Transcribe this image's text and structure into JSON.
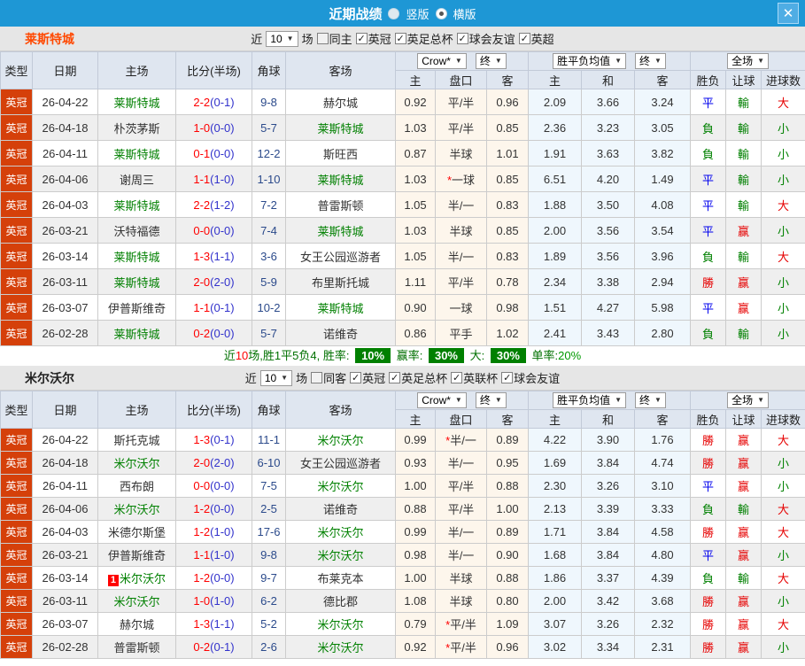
{
  "titlebar": {
    "title": "近期战绩",
    "radio_vertical": "竖版",
    "radio_horizontal": "横版"
  },
  "icons": {
    "close": "✕",
    "dropdown_arrow": "▼",
    "checkbox_check": "✓"
  },
  "colors": {
    "header_blue": "#1e97d5",
    "league_red": "#d5400a",
    "team_green": "#008000",
    "team1_orange": "#ff4800",
    "score_red": "#ff0000",
    "halftime_blue": "#3333cc",
    "win_red": "#e60000",
    "draw_blue": "#0000ee",
    "lose_green": "#008000",
    "stats_badge_green": "#008000"
  },
  "table_header": {
    "type": "类型",
    "date": "日期",
    "home": "主场",
    "score": "比分(半场)",
    "corner": "角球",
    "away": "客场",
    "odds_home": "主",
    "handicap": "盘口",
    "odds_away": "客",
    "avg_home": "主",
    "avg_draw": "和",
    "avg_away": "客",
    "result": "胜负",
    "handicap_result": "让球",
    "goals": "进球数",
    "select_company": "Crow*",
    "select_final1": "终",
    "select_avg": "胜平负均值",
    "select_final2": "终",
    "select_scope": "全场"
  },
  "sections": [
    {
      "team": "莱斯特城",
      "filter": {
        "near_label": "近",
        "count": "10",
        "games_label": "场",
        "same_label": "同主",
        "same_checked": false,
        "leagues": [
          "英冠",
          "英足总杯",
          "球会友谊",
          "英超"
        ]
      },
      "rows": [
        {
          "league": "英冠",
          "date": "26-04-22",
          "home": "莱斯特城",
          "homeGreen": true,
          "scoreFT": "2-2",
          "scoreHT": "(0-1)",
          "corner": "9-8",
          "away": "赫尔城",
          "awayGreen": false,
          "oddsH": "0.92",
          "star": false,
          "handicap": "平/半",
          "oddsA": "0.96",
          "avgH": "2.09",
          "avgD": "3.66",
          "avgA": "3.24",
          "res": "平",
          "resC": "b",
          "let": "輸",
          "letC": "g",
          "goal": "大",
          "goalC": "r"
        },
        {
          "league": "英冠",
          "date": "26-04-18",
          "home": "朴茨茅斯",
          "homeGreen": false,
          "scoreFT": "1-0",
          "scoreHT": "(0-0)",
          "corner": "5-7",
          "away": "莱斯特城",
          "awayGreen": true,
          "oddsH": "1.03",
          "star": false,
          "handicap": "平/半",
          "oddsA": "0.85",
          "avgH": "2.36",
          "avgD": "3.23",
          "avgA": "3.05",
          "res": "負",
          "resC": "g",
          "let": "輸",
          "letC": "g",
          "goal": "小",
          "goalC": "g"
        },
        {
          "league": "英冠",
          "date": "26-04-11",
          "home": "莱斯特城",
          "homeGreen": true,
          "scoreFT": "0-1",
          "scoreHT": "(0-0)",
          "corner": "12-2",
          "away": "斯旺西",
          "awayGreen": false,
          "oddsH": "0.87",
          "star": false,
          "handicap": "半球",
          "oddsA": "1.01",
          "avgH": "1.91",
          "avgD": "3.63",
          "avgA": "3.82",
          "res": "負",
          "resC": "g",
          "let": "輸",
          "letC": "g",
          "goal": "小",
          "goalC": "g"
        },
        {
          "league": "英冠",
          "date": "26-04-06",
          "home": "谢周三",
          "homeGreen": false,
          "scoreFT": "1-1",
          "scoreHT": "(1-0)",
          "corner": "1-10",
          "away": "莱斯特城",
          "awayGreen": true,
          "oddsH": "1.03",
          "star": true,
          "handicap": "一球",
          "oddsA": "0.85",
          "avgH": "6.51",
          "avgD": "4.20",
          "avgA": "1.49",
          "res": "平",
          "resC": "b",
          "let": "輸",
          "letC": "g",
          "goal": "小",
          "goalC": "g"
        },
        {
          "league": "英冠",
          "date": "26-04-03",
          "home": "莱斯特城",
          "homeGreen": true,
          "scoreFT": "2-2",
          "scoreHT": "(1-2)",
          "corner": "7-2",
          "away": "普雷斯顿",
          "awayGreen": false,
          "oddsH": "1.05",
          "star": false,
          "handicap": "半/一",
          "oddsA": "0.83",
          "avgH": "1.88",
          "avgD": "3.50",
          "avgA": "4.08",
          "res": "平",
          "resC": "b",
          "let": "輸",
          "letC": "g",
          "goal": "大",
          "goalC": "r"
        },
        {
          "league": "英冠",
          "date": "26-03-21",
          "home": "沃特福德",
          "homeGreen": false,
          "scoreFT": "0-0",
          "scoreHT": "(0-0)",
          "corner": "7-4",
          "away": "莱斯特城",
          "awayGreen": true,
          "oddsH": "1.03",
          "star": false,
          "handicap": "半球",
          "oddsA": "0.85",
          "avgH": "2.00",
          "avgD": "3.56",
          "avgA": "3.54",
          "res": "平",
          "resC": "b",
          "let": "赢",
          "letC": "r",
          "goal": "小",
          "goalC": "g"
        },
        {
          "league": "英冠",
          "date": "26-03-14",
          "home": "莱斯特城",
          "homeGreen": true,
          "scoreFT": "1-3",
          "scoreHT": "(1-1)",
          "corner": "3-6",
          "away": "女王公园巡游者",
          "awayGreen": false,
          "oddsH": "1.05",
          "star": false,
          "handicap": "半/一",
          "oddsA": "0.83",
          "avgH": "1.89",
          "avgD": "3.56",
          "avgA": "3.96",
          "res": "負",
          "resC": "g",
          "let": "輸",
          "letC": "g",
          "goal": "大",
          "goalC": "r"
        },
        {
          "league": "英冠",
          "date": "26-03-11",
          "home": "莱斯特城",
          "homeGreen": true,
          "scoreFT": "2-0",
          "scoreHT": "(2-0)",
          "corner": "5-9",
          "away": "布里斯托城",
          "awayGreen": false,
          "oddsH": "1.11",
          "star": false,
          "handicap": "平/半",
          "oddsA": "0.78",
          "avgH": "2.34",
          "avgD": "3.38",
          "avgA": "2.94",
          "res": "勝",
          "resC": "r",
          "let": "赢",
          "letC": "r",
          "goal": "小",
          "goalC": "g"
        },
        {
          "league": "英冠",
          "date": "26-03-07",
          "home": "伊普斯维奇",
          "homeGreen": false,
          "scoreFT": "1-1",
          "scoreHT": "(0-1)",
          "corner": "10-2",
          "away": "莱斯特城",
          "awayGreen": true,
          "oddsH": "0.90",
          "star": false,
          "handicap": "一球",
          "oddsA": "0.98",
          "avgH": "1.51",
          "avgD": "4.27",
          "avgA": "5.98",
          "res": "平",
          "resC": "b",
          "let": "赢",
          "letC": "r",
          "goal": "小",
          "goalC": "g"
        },
        {
          "league": "英冠",
          "date": "26-02-28",
          "home": "莱斯特城",
          "homeGreen": true,
          "scoreFT": "0-2",
          "scoreHT": "(0-0)",
          "corner": "5-7",
          "away": "诺维奇",
          "awayGreen": false,
          "oddsH": "0.86",
          "star": false,
          "handicap": "平手",
          "oddsA": "1.02",
          "avgH": "2.41",
          "avgD": "3.43",
          "avgA": "2.80",
          "res": "負",
          "resC": "g",
          "let": "輸",
          "letC": "g",
          "goal": "小",
          "goalC": "g"
        }
      ],
      "stats": {
        "t1": "近",
        "count": "10",
        "t2": "场,胜1平5负4, 胜率:",
        "win_rate": "10%",
        "t3": "赢率:",
        "let_rate": "30%",
        "t4": "大:",
        "big_rate": "30%",
        "t5": "单率:",
        "single_rate": "20%"
      }
    },
    {
      "team": "米尔沃尔",
      "filter": {
        "near_label": "近",
        "count": "10",
        "games_label": "场",
        "same_label": "同客",
        "same_checked": false,
        "leagues": [
          "英冠",
          "英足总杯",
          "英联杯",
          "球会友谊"
        ]
      },
      "rows": [
        {
          "league": "英冠",
          "date": "26-04-22",
          "home": "斯托克城",
          "homeGreen": false,
          "scoreFT": "1-3",
          "scoreHT": "(0-1)",
          "corner": "11-1",
          "away": "米尔沃尔",
          "awayGreen": true,
          "oddsH": "0.99",
          "star": true,
          "handicap": "半/一",
          "oddsA": "0.89",
          "avgH": "4.22",
          "avgD": "3.90",
          "avgA": "1.76",
          "res": "勝",
          "resC": "r",
          "let": "赢",
          "letC": "r",
          "goal": "大",
          "goalC": "r"
        },
        {
          "league": "英冠",
          "date": "26-04-18",
          "home": "米尔沃尔",
          "homeGreen": true,
          "scoreFT": "2-0",
          "scoreHT": "(2-0)",
          "corner": "6-10",
          "away": "女王公园巡游者",
          "awayGreen": false,
          "oddsH": "0.93",
          "star": false,
          "handicap": "半/一",
          "oddsA": "0.95",
          "avgH": "1.69",
          "avgD": "3.84",
          "avgA": "4.74",
          "res": "勝",
          "resC": "r",
          "let": "赢",
          "letC": "r",
          "goal": "小",
          "goalC": "g"
        },
        {
          "league": "英冠",
          "date": "26-04-11",
          "home": "西布朗",
          "homeGreen": false,
          "scoreFT": "0-0",
          "scoreHT": "(0-0)",
          "corner": "7-5",
          "away": "米尔沃尔",
          "awayGreen": true,
          "oddsH": "1.00",
          "star": false,
          "handicap": "平/半",
          "oddsA": "0.88",
          "avgH": "2.30",
          "avgD": "3.26",
          "avgA": "3.10",
          "res": "平",
          "resC": "b",
          "let": "赢",
          "letC": "r",
          "goal": "小",
          "goalC": "g"
        },
        {
          "league": "英冠",
          "date": "26-04-06",
          "home": "米尔沃尔",
          "homeGreen": true,
          "scoreFT": "1-2",
          "scoreHT": "(0-0)",
          "corner": "2-5",
          "away": "诺维奇",
          "awayGreen": false,
          "oddsH": "0.88",
          "star": false,
          "handicap": "平/半",
          "oddsA": "1.00",
          "avgH": "2.13",
          "avgD": "3.39",
          "avgA": "3.33",
          "res": "負",
          "resC": "g",
          "let": "輸",
          "letC": "g",
          "goal": "大",
          "goalC": "r"
        },
        {
          "league": "英冠",
          "date": "26-04-03",
          "home": "米德尔斯堡",
          "homeGreen": false,
          "scoreFT": "1-2",
          "scoreHT": "(1-0)",
          "corner": "17-6",
          "away": "米尔沃尔",
          "awayGreen": true,
          "oddsH": "0.99",
          "star": false,
          "handicap": "半/一",
          "oddsA": "0.89",
          "avgH": "1.71",
          "avgD": "3.84",
          "avgA": "4.58",
          "res": "勝",
          "resC": "r",
          "let": "赢",
          "letC": "r",
          "goal": "大",
          "goalC": "r"
        },
        {
          "league": "英冠",
          "date": "26-03-21",
          "home": "伊普斯维奇",
          "homeGreen": false,
          "scoreFT": "1-1",
          "scoreHT": "(1-0)",
          "corner": "9-8",
          "away": "米尔沃尔",
          "awayGreen": true,
          "oddsH": "0.98",
          "star": false,
          "handicap": "半/一",
          "oddsA": "0.90",
          "avgH": "1.68",
          "avgD": "3.84",
          "avgA": "4.80",
          "res": "平",
          "resC": "b",
          "let": "赢",
          "letC": "r",
          "goal": "小",
          "goalC": "g"
        },
        {
          "league": "英冠",
          "date": "26-03-14",
          "home": "米尔沃尔",
          "homeGreen": true,
          "badge": "1",
          "scoreFT": "1-2",
          "scoreHT": "(0-0)",
          "corner": "9-7",
          "away": "布莱克本",
          "awayGreen": false,
          "oddsH": "1.00",
          "star": false,
          "handicap": "半球",
          "oddsA": "0.88",
          "avgH": "1.86",
          "avgD": "3.37",
          "avgA": "4.39",
          "res": "負",
          "resC": "g",
          "let": "輸",
          "letC": "g",
          "goal": "大",
          "goalC": "r"
        },
        {
          "league": "英冠",
          "date": "26-03-11",
          "home": "米尔沃尔",
          "homeGreen": true,
          "scoreFT": "1-0",
          "scoreHT": "(1-0)",
          "corner": "6-2",
          "away": "德比郡",
          "awayGreen": false,
          "oddsH": "1.08",
          "star": false,
          "handicap": "半球",
          "oddsA": "0.80",
          "avgH": "2.00",
          "avgD": "3.42",
          "avgA": "3.68",
          "res": "勝",
          "resC": "r",
          "let": "赢",
          "letC": "r",
          "goal": "小",
          "goalC": "g"
        },
        {
          "league": "英冠",
          "date": "26-03-07",
          "home": "赫尔城",
          "homeGreen": false,
          "scoreFT": "1-3",
          "scoreHT": "(1-1)",
          "corner": "5-2",
          "away": "米尔沃尔",
          "awayGreen": true,
          "oddsH": "0.79",
          "star": true,
          "handicap": "平/半",
          "oddsA": "1.09",
          "avgH": "3.07",
          "avgD": "3.26",
          "avgA": "2.32",
          "res": "勝",
          "resC": "r",
          "let": "赢",
          "letC": "r",
          "goal": "大",
          "goalC": "r"
        },
        {
          "league": "英冠",
          "date": "26-02-28",
          "home": "普雷斯顿",
          "homeGreen": false,
          "scoreFT": "0-2",
          "scoreHT": "(0-1)",
          "corner": "2-6",
          "away": "米尔沃尔",
          "awayGreen": true,
          "oddsH": "0.92",
          "star": true,
          "handicap": "平/半",
          "oddsA": "0.96",
          "avgH": "3.02",
          "avgD": "3.34",
          "avgA": "2.31",
          "res": "勝",
          "resC": "r",
          "let": "赢",
          "letC": "r",
          "goal": "小",
          "goalC": "g"
        }
      ]
    }
  ]
}
